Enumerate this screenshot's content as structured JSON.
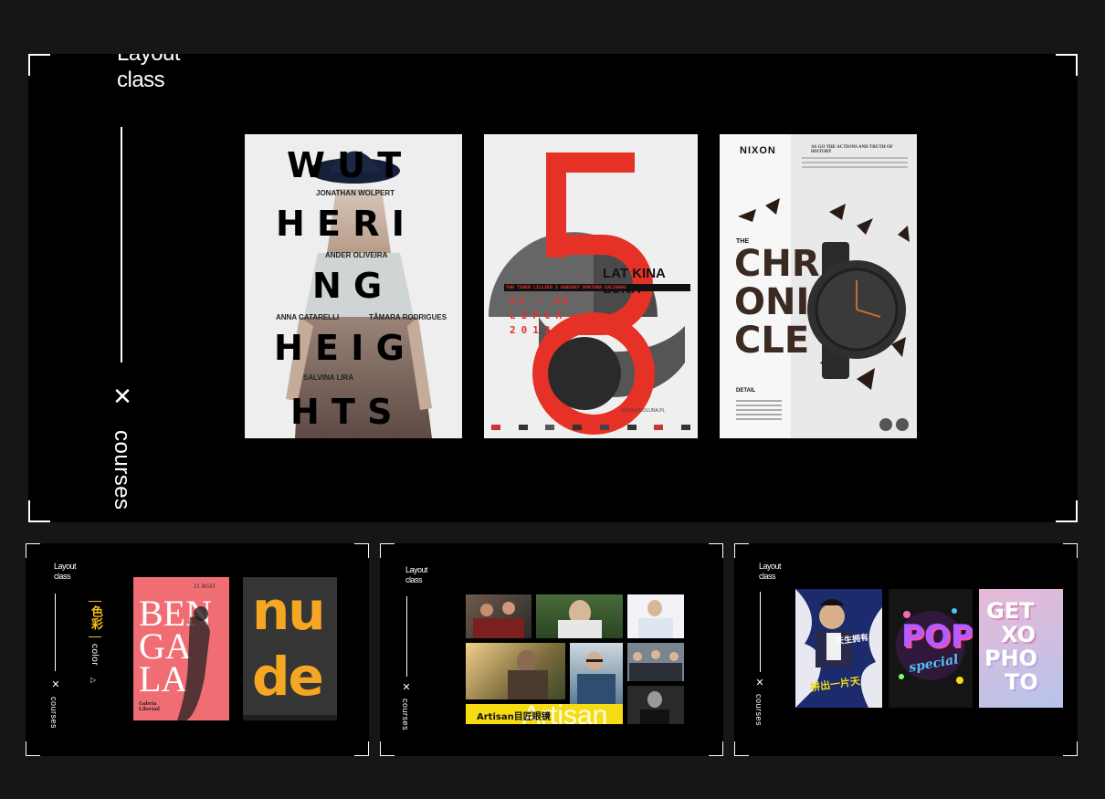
{
  "sidebar": {
    "title_line1": "Layout",
    "title_line2": "class",
    "close_symbol": "✕",
    "courses_label": "courses"
  },
  "color_label_zh": "色彩",
  "color_label_en": "color",
  "posters": {
    "wuthering": {
      "rows": [
        "W U T",
        "H E R I",
        "N G",
        "H E I G",
        "H T S"
      ],
      "credits": [
        "JONATHAN WOLPERT",
        "ANDER OLIVEIRA",
        "ANNA CATARELLI",
        "TÂMARA RODRIGUES",
        "SALVINA LIRA"
      ]
    },
    "lipca": {
      "title": "LAT KINA LUNA",
      "big_number": "5",
      "date_line1": "21 – 22",
      "date_line2": "LIPCA",
      "date_line3": "2012",
      "caption": "THE TIGER LILLIES I GABINET DOKTORA CALIGARI",
      "website": "WWW.KINOLUNA.PL"
    },
    "nixon": {
      "brand": "NIXON",
      "headline": "AS GO THE ACTIONS AND TRUTH OF HISTORY",
      "the": "THE",
      "big_lines": [
        "CHR",
        "ONI",
        "CLE"
      ],
      "detail": "DETAIL"
    },
    "bengala": {
      "lines": [
        "BEN",
        "GA",
        "LA"
      ],
      "date": "11 AGO",
      "footer": "Galería Libertad"
    },
    "nude": {
      "line1": "nu",
      "line2": "de"
    },
    "artisan": {
      "banner": "Artisan目匠眼镜",
      "big": "Artisan"
    },
    "zh_poster": {
      "line1": "天生拥有",
      "line2": "拼出一片天"
    },
    "pop": {
      "word": "POP",
      "sub": "special"
    },
    "getxo": {
      "lines": [
        "GET",
        "XO",
        "PHO",
        "TO"
      ]
    }
  }
}
